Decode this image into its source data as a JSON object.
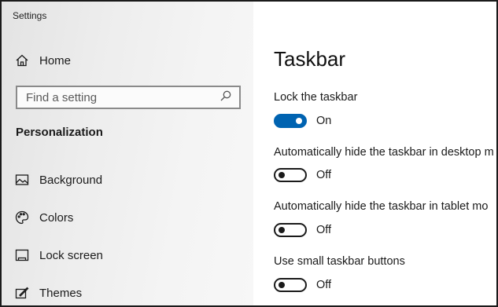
{
  "window": {
    "title": "Settings"
  },
  "sidebar": {
    "home_label": "Home",
    "search_placeholder": "Find a setting",
    "section_title": "Personalization",
    "items": [
      {
        "label": "Background",
        "icon": "image-icon"
      },
      {
        "label": "Colors",
        "icon": "palette-icon"
      },
      {
        "label": "Lock screen",
        "icon": "lock-screen-icon"
      },
      {
        "label": "Themes",
        "icon": "themes-icon"
      }
    ]
  },
  "main": {
    "title": "Taskbar",
    "settings": [
      {
        "label": "Lock the taskbar",
        "state": "On",
        "on": true
      },
      {
        "label": "Automatically hide the taskbar in desktop m",
        "state": "Off",
        "on": false
      },
      {
        "label": "Automatically hide the taskbar in tablet mo",
        "state": "Off",
        "on": false
      },
      {
        "label": "Use small taskbar buttons",
        "state": "Off",
        "on": false
      }
    ]
  },
  "colors": {
    "accent": "#0063b1"
  }
}
